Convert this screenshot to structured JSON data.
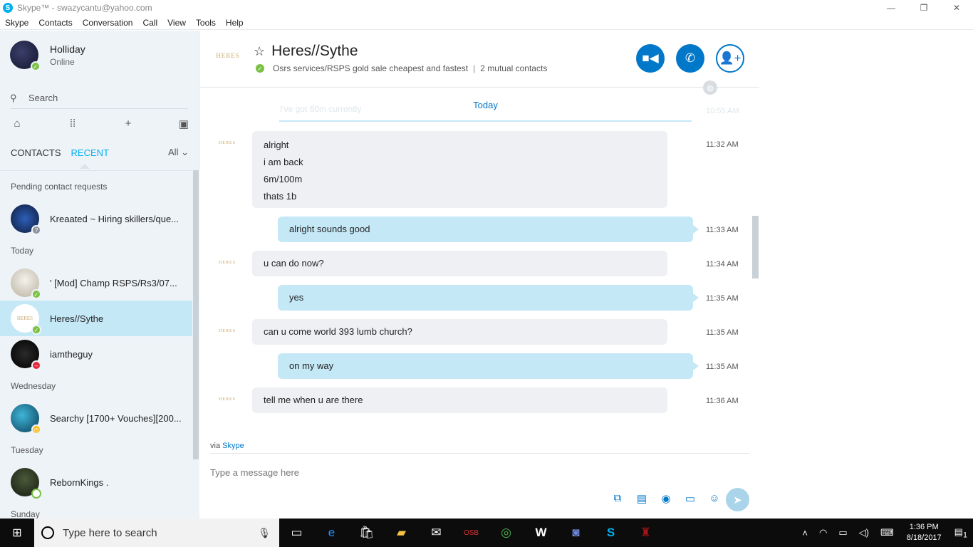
{
  "window": {
    "title": "Skype™ - swazycantu@yahoo.com",
    "app_icon_letter": "S",
    "controls": [
      "—",
      "❐",
      "✕"
    ]
  },
  "menu": [
    "Skype",
    "Contacts",
    "Conversation",
    "Call",
    "View",
    "Tools",
    "Help"
  ],
  "profile": {
    "name": "Holliday",
    "status": "Online"
  },
  "search": {
    "placeholder": "Search"
  },
  "tabs": {
    "contacts": "CONTACTS",
    "recent": "RECENT",
    "filter": "All"
  },
  "sections": {
    "pending": "Pending contact requests",
    "today": "Today",
    "wednesday": "Wednesday",
    "tuesday": "Tuesday",
    "sunday": "Sunday"
  },
  "contacts": [
    {
      "name": "Kreaated ~ Hiring skillers/que...",
      "status": "unknown"
    },
    {
      "name": "' [Mod] Champ RSPS/Rs3/07...",
      "status": "online"
    },
    {
      "name": "Heres//Sythe",
      "status": "online"
    },
    {
      "name": "iamtheguy",
      "status": "dnd"
    },
    {
      "name": "Searchy [1700+ Vouches][200...",
      "status": "away"
    },
    {
      "name": "RebornKings .",
      "status": "offline"
    }
  ],
  "conversation": {
    "logo_text": "HERES",
    "name": "Heres//Sythe",
    "mood": "Osrs services/RSPS gold sale cheapest and fastest",
    "mutual": "2 mutual contacts",
    "divider": "Today",
    "faded_msg": "I've got 60m currently",
    "faded_time": "10:55 AM"
  },
  "messages": [
    {
      "dir": "in",
      "lines": "alright\ni am back\n6m/100m\nthats 1b",
      "time": "11:32 AM"
    },
    {
      "dir": "out",
      "lines": "alright sounds good",
      "time": "11:33 AM"
    },
    {
      "dir": "in",
      "lines": "u can do now?",
      "time": "11:34 AM"
    },
    {
      "dir": "out",
      "lines": "yes",
      "time": "11:35 AM"
    },
    {
      "dir": "in",
      "lines": "can u come world 393 lumb church?",
      "time": "11:35 AM"
    },
    {
      "dir": "out",
      "lines": "on my way",
      "time": "11:35 AM"
    },
    {
      "dir": "in",
      "lines": "tell me when u are there",
      "time": "11:36 AM"
    }
  ],
  "compose": {
    "via": "via",
    "via_link": "Skype",
    "placeholder": "Type a message here"
  },
  "taskbar": {
    "search_placeholder": "Type here to search",
    "time": "1:36 PM",
    "date": "8/18/2017",
    "notification_count": "1"
  },
  "colors": {
    "accent": "#00aff0",
    "button_blue": "#0078ca",
    "outgoing_bubble": "#c5e8f7",
    "incoming_bubble": "#eef0f3",
    "selected_row": "#c5e8f7"
  }
}
